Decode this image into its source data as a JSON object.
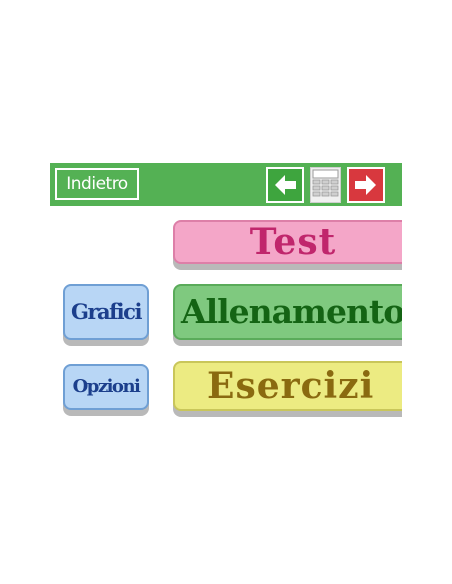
{
  "topbar": {
    "back_label": "Indietro",
    "icons": [
      "arrow-left-icon",
      "calculator-icon",
      "arrow-right-icon"
    ],
    "color": "#54b154"
  },
  "menu": {
    "test_label": "Test",
    "allenamento_label": "Allenamento",
    "esercizi_label": "Esercizi",
    "grafici_label": "Grafici",
    "opzioni_label": "Opzioni"
  },
  "colors": {
    "test": "#f4a6c8",
    "allenamento": "#7fc97f",
    "esercizi": "#eceb82",
    "side": "#b8d6f5",
    "next": "#d8383e"
  }
}
